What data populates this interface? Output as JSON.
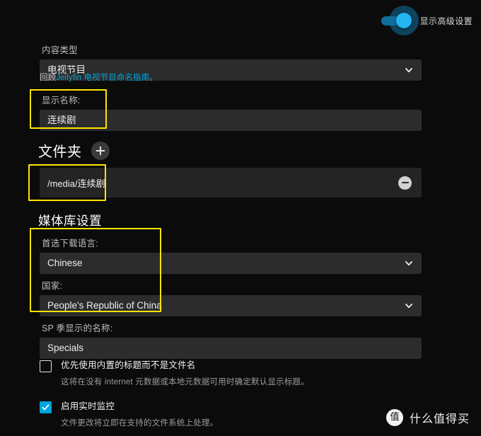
{
  "header": {
    "advanced_toggle_label": "显示高级设置",
    "advanced_toggle_state": "on"
  },
  "content_type": {
    "label": "内容类型",
    "value": "电视节目",
    "chevron_icon": "chevron-down-icon"
  },
  "helper": {
    "prefix": "回顾",
    "link_text": "Jellyfin 电视节目命名指南",
    "suffix": "。"
  },
  "display_name": {
    "label": "显示名称:",
    "value": "连续剧"
  },
  "folders": {
    "heading": "文件夹",
    "add_icon": "plus-icon",
    "items": [
      {
        "path": "/media/连续剧",
        "remove_icon": "minus-circle-icon"
      }
    ]
  },
  "library_settings": {
    "heading": "媒体库设置",
    "language": {
      "label": "首选下载语言:",
      "value": "Chinese",
      "chevron_icon": "chevron-down-icon"
    },
    "country": {
      "label": "国家:",
      "value": "People's Republic of China",
      "chevron_icon": "chevron-down-icon"
    },
    "specials": {
      "label": "SP 季显示的名称:",
      "value": "Specials"
    }
  },
  "checkboxes": [
    {
      "title": "优先使用内置的标题而不是文件名",
      "description": "这将在没有 internet 元数据或本地元数据可用时确定默认显示标题。",
      "checked": false
    },
    {
      "title": "启用实时监控",
      "description": "文件更改将立即在支持的文件系统上处理。",
      "checked": true
    }
  ],
  "watermark": {
    "logo_glyph": "值",
    "text": "什么值得买"
  },
  "colors": {
    "accent": "#00a4dc",
    "toggle_knob": "#23b5ef",
    "annotation": "#ffe500",
    "background": "#0b0b0b",
    "field_background": "#2c2c2c"
  }
}
